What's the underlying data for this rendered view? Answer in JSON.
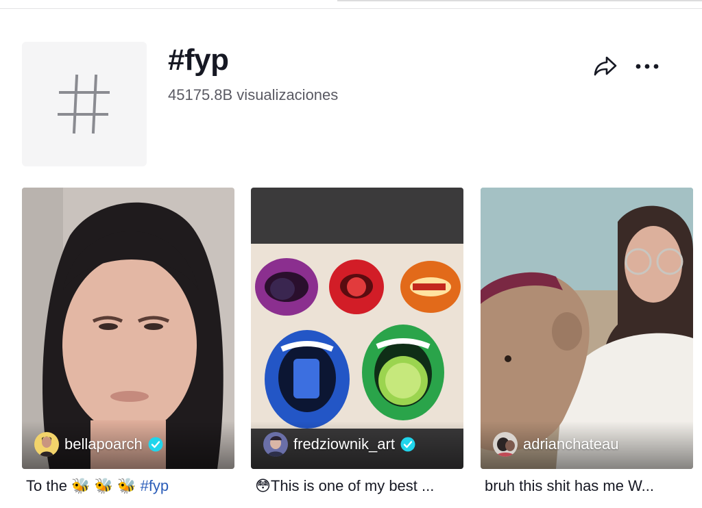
{
  "hashtag": {
    "title": "#fyp",
    "views": "45175.8B visualizaciones",
    "cover_icon": "hashtag-icon"
  },
  "actions": {
    "share_icon": "share-icon",
    "more_icon": "more-dots-icon"
  },
  "videos": [
    {
      "author": "bellapoarch",
      "verified": true,
      "caption_prefix": "To the 🐝 🐝 🐝",
      "caption_tag": "#fyp"
    },
    {
      "author": "fredziownik_art",
      "verified": true,
      "caption_prefix": "😳This is one of my best ...",
      "caption_tag": ""
    },
    {
      "author": "adrianchateau",
      "verified": false,
      "caption_prefix": "bruh this shit has me W...",
      "caption_tag": ""
    }
  ],
  "colors": {
    "verified_badge": "#20d5ec",
    "hashtag_link": "#2b5db9",
    "cover_bg": "#f5f5f6"
  }
}
